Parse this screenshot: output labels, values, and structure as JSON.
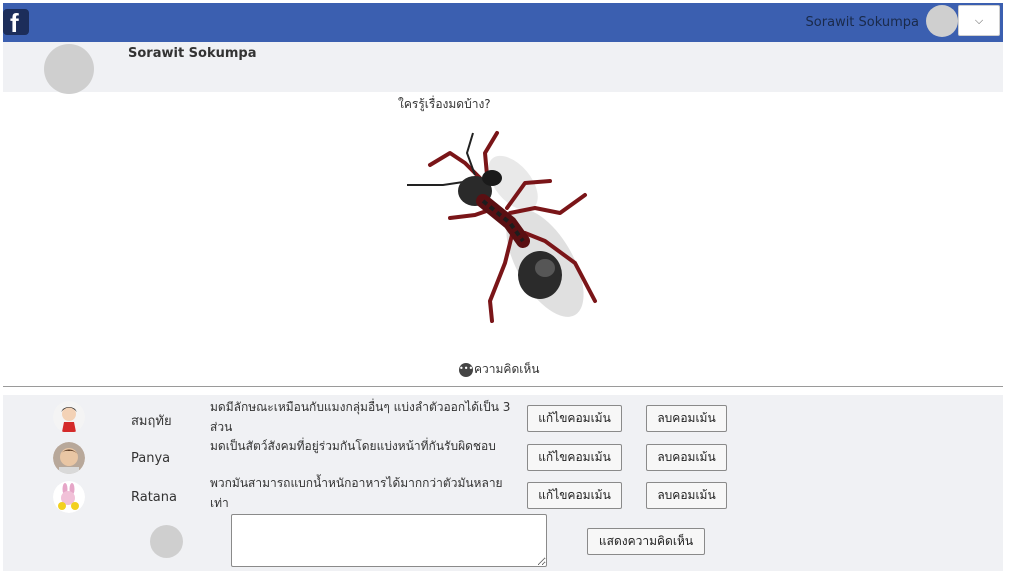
{
  "header": {
    "username": "Sorawit Sokumpa",
    "logo_letter": "f",
    "dropdown_icon": "⌵"
  },
  "profile": {
    "name": "Sorawit Sokumpa"
  },
  "post": {
    "text": "ใครรู้เรื่องมดบ้าง?",
    "image_icon": "ant-illustration",
    "comment_label": "ความคิดเห็น"
  },
  "comments": [
    {
      "name": "สมฤทัย",
      "text": "มดมีลักษณะเหมือนกับแมงกลุ่มอื่นๆ แบ่งลำตัวออกได้เป็น 3 ส่วน",
      "edit_label": "แก้ไขคอมเม้น",
      "delete_label": "ลบคอมเม้น"
    },
    {
      "name": "Panya",
      "text": "มดเป็นสัตว์สังคมที่อยู่ร่วมกันโดยแบ่งหน้าที่กันรับผิดชอบ",
      "edit_label": "แก้ไขคอมเม้น",
      "delete_label": "ลบคอมเม้น"
    },
    {
      "name": "Ratana",
      "text": "พวกมันสามารถแบกน้ำหนักอาหารได้มากกว่าตัวมันหลายเท่า",
      "edit_label": "แก้ไขคอมเม้น",
      "delete_label": "ลบคอมเม้น"
    }
  ],
  "composer": {
    "comment_value": "",
    "show_button": "แสดงความคิดเห็น"
  },
  "colors": {
    "topbar": "#3b5fb0",
    "panel": "#f0f1f4"
  }
}
